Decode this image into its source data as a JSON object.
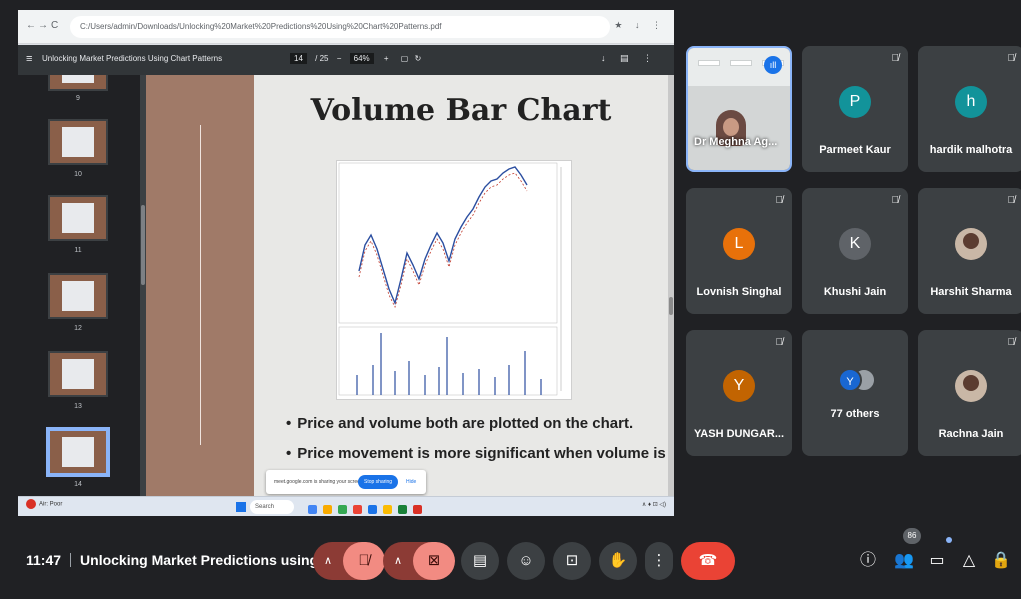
{
  "browser": {
    "url": "C:/Users/admin/Downloads/Unlocking%20Market%20Predictions%20Using%20Chart%20Patterns.pdf",
    "nav": "← → C"
  },
  "pdf": {
    "menu_icon": "menu-icon",
    "doc_title": "Unlocking Market Predictions Using Chart Patterns",
    "page_current": "14",
    "page_total": "/ 25",
    "zoom": "64%",
    "thumbnail_numbers": [
      "9",
      "10",
      "11",
      "12",
      "13",
      "14"
    ],
    "selected_thumbnail": "14"
  },
  "slide": {
    "title": "Volume Bar Chart",
    "bullets": [
      "Price and volume both are plotted on the chart.",
      "Price movement is more significant when volume is"
    ]
  },
  "screen_share": {
    "notice": "meet.google.com is sharing your screen.",
    "stop_label": "Stop sharing",
    "hide_label": "Hide"
  },
  "taskbar": {
    "weather": "Air: Poor",
    "search": "Search",
    "app_colors": [
      "#4285f4",
      "#f9ab00",
      "#34a853",
      "#ea4335",
      "#1a73e8",
      "#fbbc04",
      "#188038",
      "#d93025"
    ]
  },
  "participants": [
    {
      "name": "Dr Meghna Ag...",
      "type": "video",
      "muted": false,
      "speaking": true
    },
    {
      "name": "Parmeet Kaur",
      "initial": "P",
      "color": "#12939a",
      "muted": true
    },
    {
      "name": "hardik malhotra",
      "initial": "h",
      "color": "#12939a",
      "muted": true
    },
    {
      "name": "Lovnish Singhal",
      "initial": "L",
      "color": "#e8710a",
      "muted": true
    },
    {
      "name": "Khushi Jain",
      "initial": "K",
      "color": "#5f6368",
      "muted": true
    },
    {
      "name": "Harshit Sharma",
      "type": "photo",
      "muted": true
    },
    {
      "name": "YASH DUNGAR...",
      "initial": "Y",
      "color": "#c26401",
      "muted": true
    },
    {
      "name": "77 others",
      "type": "group",
      "initial": "Y",
      "muted": false
    },
    {
      "name": "Rachna Jain",
      "type": "photo",
      "muted": true
    }
  ],
  "meeting": {
    "time": "11:47",
    "title": "Unlocking Market Predictions using C...",
    "participant_count": "86"
  },
  "colors": {
    "background": "#202124",
    "tile": "#3c4043",
    "accent": "#8ab4f8",
    "danger": "#ea4335"
  }
}
